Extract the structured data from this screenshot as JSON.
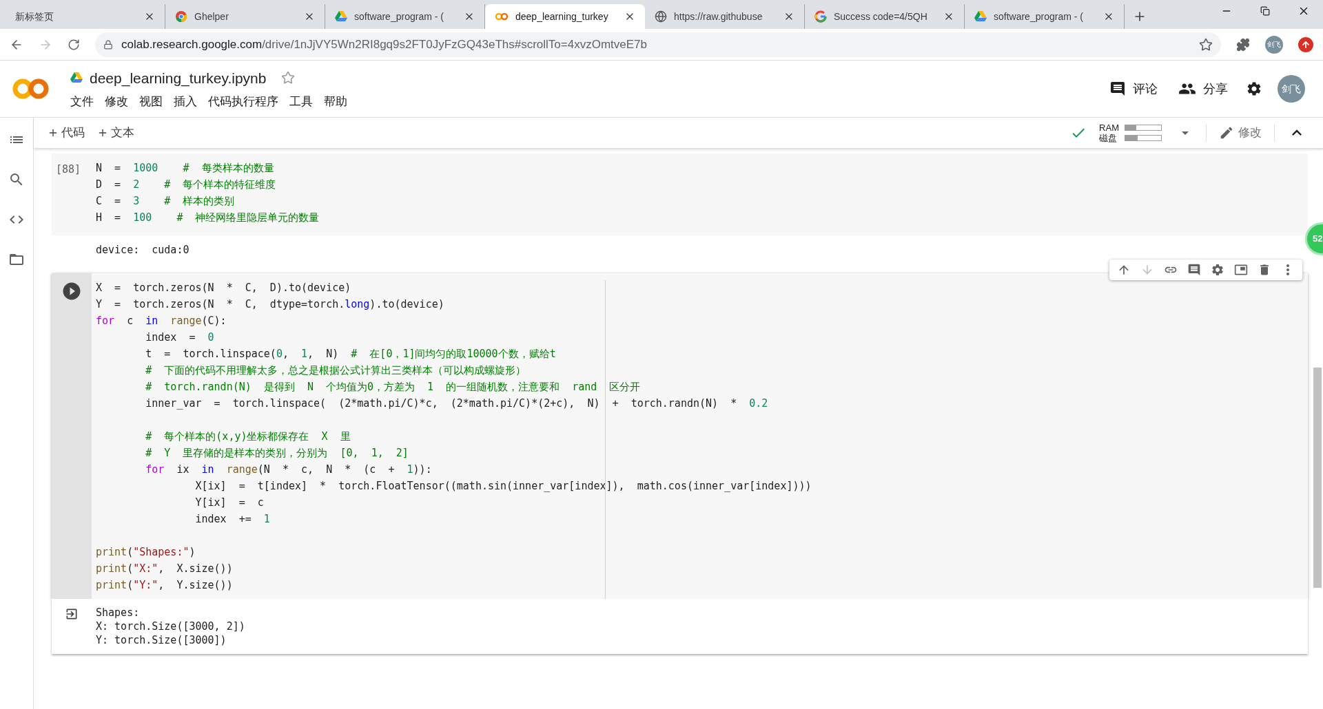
{
  "browser": {
    "tabs": [
      {
        "title": "新标签页",
        "kind": "blank",
        "selected": false
      },
      {
        "title": "Ghelper",
        "kind": "chrome",
        "selected": false
      },
      {
        "title": "software_program - (",
        "kind": "drive",
        "selected": false
      },
      {
        "title": "deep_learning_turkey",
        "kind": "colab",
        "selected": true
      },
      {
        "title": "https://raw.githubuse",
        "kind": "globe",
        "selected": false
      },
      {
        "title": "Success code=4/5QH",
        "kind": "google",
        "selected": false
      },
      {
        "title": "software_program - (",
        "kind": "drive",
        "selected": false
      }
    ],
    "url": {
      "host": "colab.research.google.com",
      "path": "/drive/1nJjVY5Wn2RI8gq9s2FT0JyFzGQ43eThs#scrollTo=4xvzOmtveE7b"
    },
    "bookmarked": false,
    "profile": "剑飞"
  },
  "notebook": {
    "title": "deep_learning_turkey.ipynb",
    "starred": false,
    "menu": [
      "文件",
      "修改",
      "视图",
      "插入",
      "代码执行程序",
      "工具",
      "帮助"
    ],
    "comment": "评论",
    "share": "分享",
    "avatar": "剑飞",
    "toolbar": {
      "add_code": "代码",
      "add_text": "文本",
      "connected": true,
      "ram_label": "RAM",
      "disk_label": "磁盘",
      "ram": {
        "level": 0.3
      },
      "disk": {
        "level": 0.35
      },
      "edit": "修改"
    },
    "cell_toolbar": [
      {
        "kind": "up",
        "disabled": false
      },
      {
        "kind": "down",
        "disabled": true
      },
      {
        "kind": "link",
        "disabled": false
      },
      {
        "kind": "comment",
        "disabled": false
      },
      {
        "kind": "settings",
        "disabled": false
      },
      {
        "kind": "mirror",
        "disabled": false
      },
      {
        "kind": "delete",
        "disabled": false
      },
      {
        "kind": "more",
        "disabled": false
      }
    ],
    "side_badge": "52",
    "cells": [
      {
        "prompt": "[88]",
        "focused": false,
        "lines": [
          {
            "kind": "code",
            "tokens": [
              {
                "kind": "plain",
                "text": "N  =  "
              },
              {
                "kind": "num",
                "text": "1000"
              },
              {
                "kind": "comment",
                "text": "    #  每类样本的数量"
              }
            ]
          },
          {
            "kind": "code",
            "tokens": [
              {
                "kind": "plain",
                "text": "D  =  "
              },
              {
                "kind": "num",
                "text": "2"
              },
              {
                "kind": "comment",
                "text": "    #  每个样本的特征维度"
              }
            ]
          },
          {
            "kind": "code",
            "tokens": [
              {
                "kind": "plain",
                "text": "C  =  "
              },
              {
                "kind": "num",
                "text": "3"
              },
              {
                "kind": "comment",
                "text": "    #  样本的类别"
              }
            ]
          },
          {
            "kind": "code",
            "tokens": [
              {
                "kind": "plain",
                "text": "H  =  "
              },
              {
                "kind": "num",
                "text": "100"
              },
              {
                "kind": "comment",
                "text": "    #  神经网络里隐层单元的数量"
              }
            ]
          }
        ],
        "output": [
          "device:  cuda:0"
        ]
      },
      {
        "focused": true,
        "lines": [
          {
            "kind": "code",
            "tokens": [
              {
                "kind": "plain",
                "text": "X  =  torch.zeros(N  *  C,  D).to(device)"
              }
            ]
          },
          {
            "kind": "code",
            "tokens": [
              {
                "kind": "plain",
                "text": "Y  =  torch.zeros(N  *  C,  dtype=torch."
              },
              {
                "kind": "keyword2",
                "text": "long"
              },
              {
                "kind": "plain",
                "text": ").to(device)"
              }
            ]
          },
          {
            "kind": "code",
            "tokens": [
              {
                "kind": "keyword",
                "text": "for"
              },
              {
                "kind": "plain",
                "text": "  c  "
              },
              {
                "kind": "keyword2",
                "text": "in"
              },
              {
                "kind": "builtin",
                "text": "  range"
              },
              {
                "kind": "plain",
                "text": "(C):"
              }
            ]
          },
          {
            "kind": "code",
            "tokens": [
              {
                "kind": "plain",
                "text": "        index  =  "
              },
              {
                "kind": "num",
                "text": "0"
              }
            ]
          },
          {
            "kind": "code",
            "tokens": [
              {
                "kind": "plain",
                "text": "        t  =  torch.linspace("
              },
              {
                "kind": "num",
                "text": "0"
              },
              {
                "kind": "plain",
                "text": ",  "
              },
              {
                "kind": "num",
                "text": "1"
              },
              {
                "kind": "plain",
                "text": ",  N)  "
              },
              {
                "kind": "comment",
                "text": "#  在[0，1]间均匀的取10000个数，赋给t"
              }
            ]
          },
          {
            "kind": "code",
            "tokens": [
              {
                "kind": "comment",
                "text": "        #  下面的代码不用理解太多，总之是根据公式计算出三类样本（可以构成螺旋形）"
              }
            ]
          },
          {
            "kind": "code",
            "tokens": [
              {
                "kind": "comment",
                "text": "        #  torch.randn(N)  是得到  N  个均值为0，方差为  1  的一组随机数，注意要和  rand  区分开"
              }
            ]
          },
          {
            "kind": "code",
            "tokens": [
              {
                "kind": "plain",
                "text": "        inner_var  =  torch.linspace(  (2*math.pi/C)*c,  (2*math.pi/C)*(2+c),  N)  +  torch.randn(N)  *  "
              },
              {
                "kind": "num",
                "text": "0.2"
              }
            ]
          },
          {
            "kind": "blank"
          },
          {
            "kind": "code",
            "tokens": [
              {
                "kind": "comment",
                "text": "        #  每个样本的(x,y)坐标都保存在  X  里"
              }
            ]
          },
          {
            "kind": "code",
            "tokens": [
              {
                "kind": "comment",
                "text": "        #  Y  里存储的是样本的类别，分别为  [0,  1,  2]"
              }
            ]
          },
          {
            "kind": "code",
            "tokens": [
              {
                "kind": "keyword",
                "text": "        for"
              },
              {
                "kind": "plain",
                "text": "  ix  "
              },
              {
                "kind": "keyword2",
                "text": "in"
              },
              {
                "kind": "builtin",
                "text": "  range"
              },
              {
                "kind": "plain",
                "text": "(N  *  c,  N  *  (c  +  "
              },
              {
                "kind": "num",
                "text": "1"
              },
              {
                "kind": "plain",
                "text": ")):"
              }
            ]
          },
          {
            "kind": "code",
            "tokens": [
              {
                "kind": "plain",
                "text": "                X[ix]  =  t[index]  *  torch.FloatTensor((math.sin(inner_var[index]),  math.cos(inner_var[index])))"
              }
            ]
          },
          {
            "kind": "code",
            "tokens": [
              {
                "kind": "plain",
                "text": "                Y[ix]  =  c"
              }
            ]
          },
          {
            "kind": "code",
            "tokens": [
              {
                "kind": "plain",
                "text": "                index  +=  "
              },
              {
                "kind": "num",
                "text": "1"
              }
            ]
          },
          {
            "kind": "blank"
          },
          {
            "kind": "code",
            "tokens": [
              {
                "kind": "builtin",
                "text": "print"
              },
              {
                "kind": "plain",
                "text": "("
              },
              {
                "kind": "string",
                "text": "\"Shapes:\""
              },
              {
                "kind": "plain",
                "text": ")"
              }
            ]
          },
          {
            "kind": "code",
            "tokens": [
              {
                "kind": "builtin",
                "text": "print"
              },
              {
                "kind": "plain",
                "text": "("
              },
              {
                "kind": "string",
                "text": "\"X:\""
              },
              {
                "kind": "plain",
                "text": ",  X.size())"
              }
            ]
          },
          {
            "kind": "code",
            "tokens": [
              {
                "kind": "builtin",
                "text": "print"
              },
              {
                "kind": "plain",
                "text": "("
              },
              {
                "kind": "string",
                "text": "\"Y:\""
              },
              {
                "kind": "plain",
                "text": ",  Y.size())"
              }
            ]
          }
        ],
        "output": [
          "Shapes:",
          "X: torch.Size([3000, 2])",
          "Y: torch.Size([3000])"
        ]
      }
    ]
  }
}
